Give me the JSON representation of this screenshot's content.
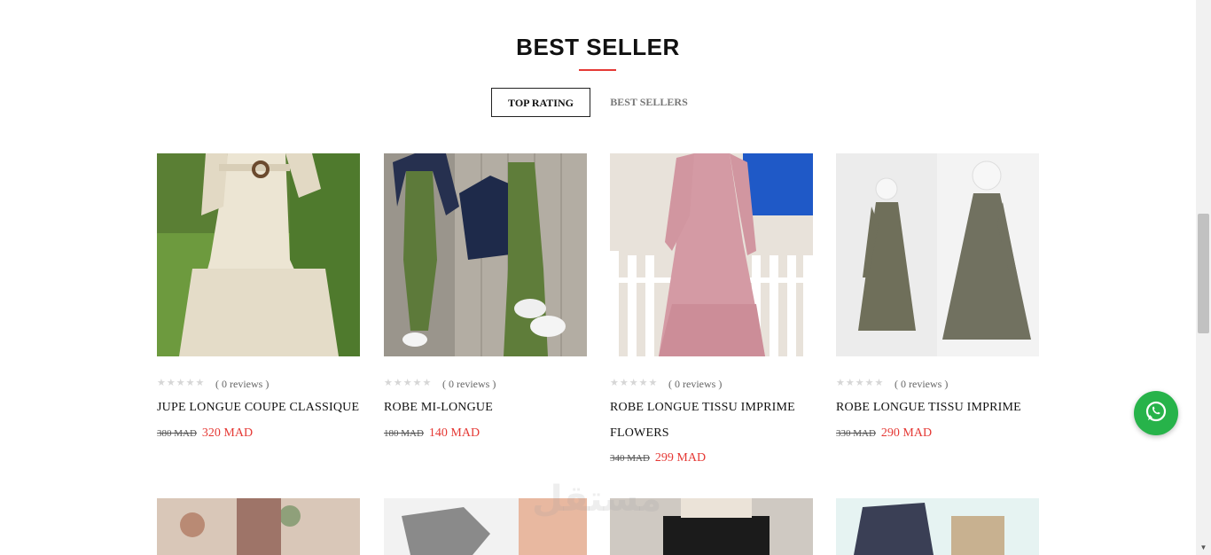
{
  "section": {
    "title": "BEST SELLER",
    "tabs": [
      {
        "label": "TOP RATING",
        "active": true
      },
      {
        "label": "BEST SELLERS",
        "active": false
      }
    ]
  },
  "products": [
    {
      "name": "JUPE LONGUE COUPE CLASSIQUE",
      "stars": "★★★★★",
      "reviews": "( 0 reviews )",
      "old_price": "380 MAD",
      "new_price": "320 MAD",
      "image": "beige-dress-photo"
    },
    {
      "name": "ROBE MI-LONGUE",
      "stars": "★★★★★",
      "reviews": "( 0 reviews )",
      "old_price": "180 MAD",
      "new_price": "140 MAD",
      "image": "green-dress-denim-jacket-photo"
    },
    {
      "name": "ROBE LONGUE TISSU IMPRIME FLOWERS",
      "stars": "★★★★★",
      "reviews": "( 0 reviews )",
      "old_price": "340 MAD",
      "new_price": "299 MAD",
      "image": "pink-floral-dress-photo"
    },
    {
      "name": "ROBE LONGUE TISSU IMPRIME",
      "stars": "★★★★★",
      "reviews": "( 0 reviews )",
      "old_price": "330 MAD",
      "new_price": "290 MAD",
      "image": "olive-printed-dress-photo"
    }
  ],
  "next_row_images": [
    "floral-blouse-photo",
    "grey-top-photo",
    "black-skirt-photo",
    "floral-shirt-photo"
  ],
  "colors": {
    "accent": "#e53935",
    "whatsapp": "#27b34a"
  },
  "icons": {
    "whatsapp": "whatsapp-icon"
  }
}
